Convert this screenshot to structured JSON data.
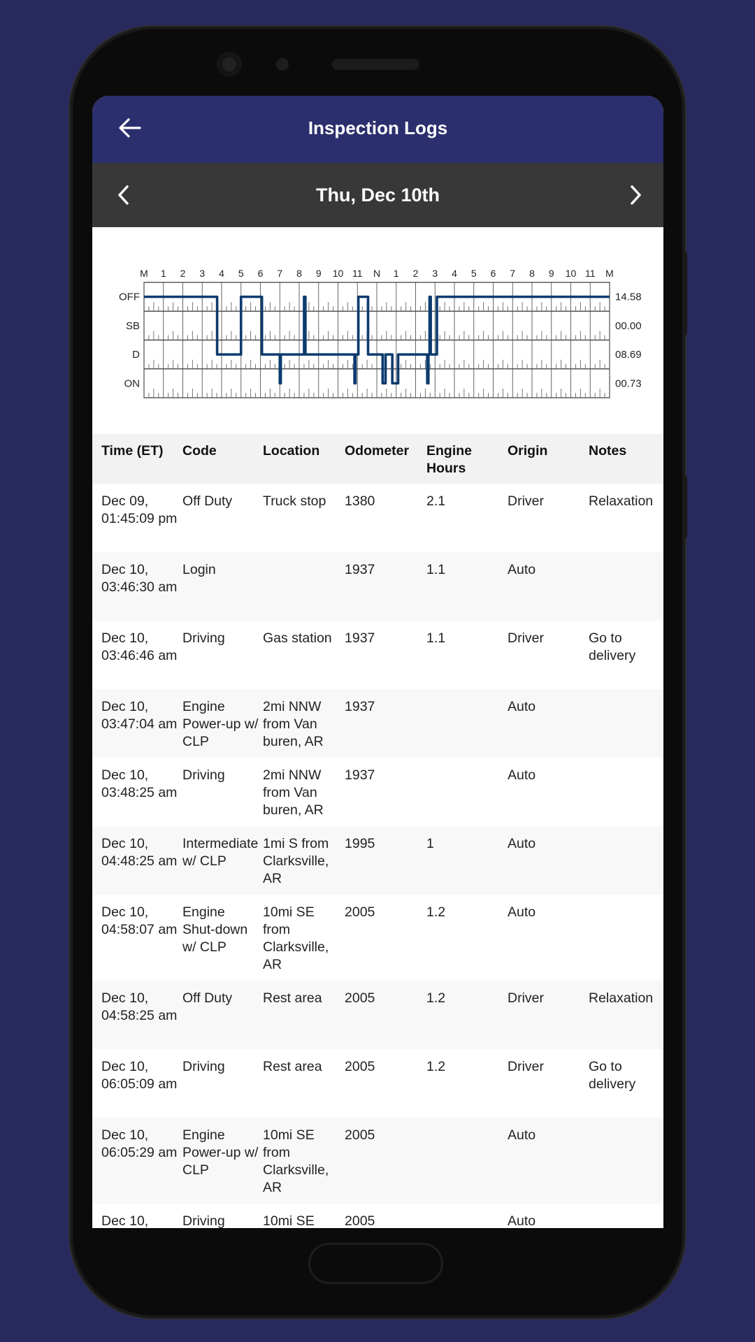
{
  "app_bar": {
    "title": "Inspection Logs",
    "back_icon": "arrow-left-icon"
  },
  "date_nav": {
    "date": "Thu, Dec 10th",
    "prev_icon": "chevron-left-icon",
    "next_icon": "chevron-right-icon"
  },
  "colors": {
    "background": "#282a5e",
    "app_bar": "#2b2f6d",
    "date_bar": "#383838",
    "graph_line": "#0d3b6e",
    "table_header": "#f2f2f2"
  },
  "chart_data": {
    "type": "line",
    "hour_labels": [
      "M",
      "1",
      "2",
      "3",
      "4",
      "5",
      "6",
      "7",
      "8",
      "9",
      "10",
      "11",
      "N",
      "1",
      "2",
      "3",
      "4",
      "5",
      "6",
      "7",
      "8",
      "9",
      "10",
      "11",
      "M"
    ],
    "statuses": [
      "OFF",
      "SB",
      "D",
      "ON"
    ],
    "totals": [
      "14.58",
      "00.00",
      "08.69",
      "00.73"
    ],
    "xlim": [
      0,
      24
    ],
    "segments": [
      [
        "OFF",
        0,
        3.77
      ],
      [
        "D",
        3.77,
        5.0
      ],
      [
        "OFF",
        5.0,
        6.08
      ],
      [
        "D",
        6.08,
        7.0
      ],
      [
        "ON",
        7.0,
        7.05
      ],
      [
        "D",
        7.05,
        8.25
      ],
      [
        "OFF",
        8.25,
        8.32
      ],
      [
        "D",
        8.32,
        10.85
      ],
      [
        "ON",
        10.85,
        10.9
      ],
      [
        "D",
        10.9,
        11.05
      ],
      [
        "OFF",
        11.05,
        11.55
      ],
      [
        "D",
        11.55,
        12.3
      ],
      [
        "ON",
        12.3,
        12.45
      ],
      [
        "D",
        12.45,
        12.8
      ],
      [
        "ON",
        12.8,
        13.1
      ],
      [
        "D",
        13.1,
        14.6
      ],
      [
        "ON",
        14.6,
        14.66
      ],
      [
        "D",
        14.66,
        14.72
      ],
      [
        "OFF",
        14.72,
        14.78
      ],
      [
        "D",
        14.78,
        15.1
      ],
      [
        "OFF",
        15.1,
        24
      ]
    ]
  },
  "table": {
    "headers": [
      "Time (ET)",
      "Code",
      "Location",
      "Odometer",
      "Engine Hours",
      "Origin",
      "Notes"
    ],
    "rows": [
      [
        "Dec 09, 01:45:09 pm",
        "Off Duty",
        "Truck stop",
        "1380",
        "2.1",
        "Driver",
        "Relaxation"
      ],
      [
        "Dec 10, 03:46:30 am",
        "Login",
        "",
        "1937",
        "1.1",
        "Auto",
        ""
      ],
      [
        "Dec 10, 03:46:46 am",
        "Driving",
        "Gas station",
        "1937",
        "1.1",
        "Driver",
        "Go to delivery"
      ],
      [
        "Dec 10, 03:47:04 am",
        "Engine Power-up w/ CLP",
        "2mi NNW from Van buren, AR",
        "1937",
        "",
        "Auto",
        ""
      ],
      [
        "Dec 10, 03:48:25 am",
        "Driving",
        "2mi NNW from Van buren, AR",
        "1937",
        "",
        "Auto",
        ""
      ],
      [
        "Dec 10, 04:48:25 am",
        "Intermediate w/ CLP",
        "1mi S from Clarksville, AR",
        "1995",
        "1",
        "Auto",
        ""
      ],
      [
        "Dec 10, 04:58:07 am",
        "Engine Shut-down w/ CLP",
        "10mi SE from Clarksville, AR",
        "2005",
        "1.2",
        "Auto",
        ""
      ],
      [
        "Dec 10, 04:58:25 am",
        "Off Duty",
        "Rest area",
        "2005",
        "1.2",
        "Driver",
        "Relaxation"
      ],
      [
        "Dec 10, 06:05:09 am",
        "Driving",
        "Rest area",
        "2005",
        "1.2",
        "Driver",
        "Go to delivery"
      ],
      [
        "Dec 10, 06:05:29 am",
        "Engine Power-up w/ CLP",
        "10mi SE from Clarksville, AR",
        "2005",
        "",
        "Auto",
        ""
      ],
      [
        "Dec 10,",
        "Driving",
        "10mi SE",
        "2005",
        "",
        "Auto",
        ""
      ]
    ]
  }
}
